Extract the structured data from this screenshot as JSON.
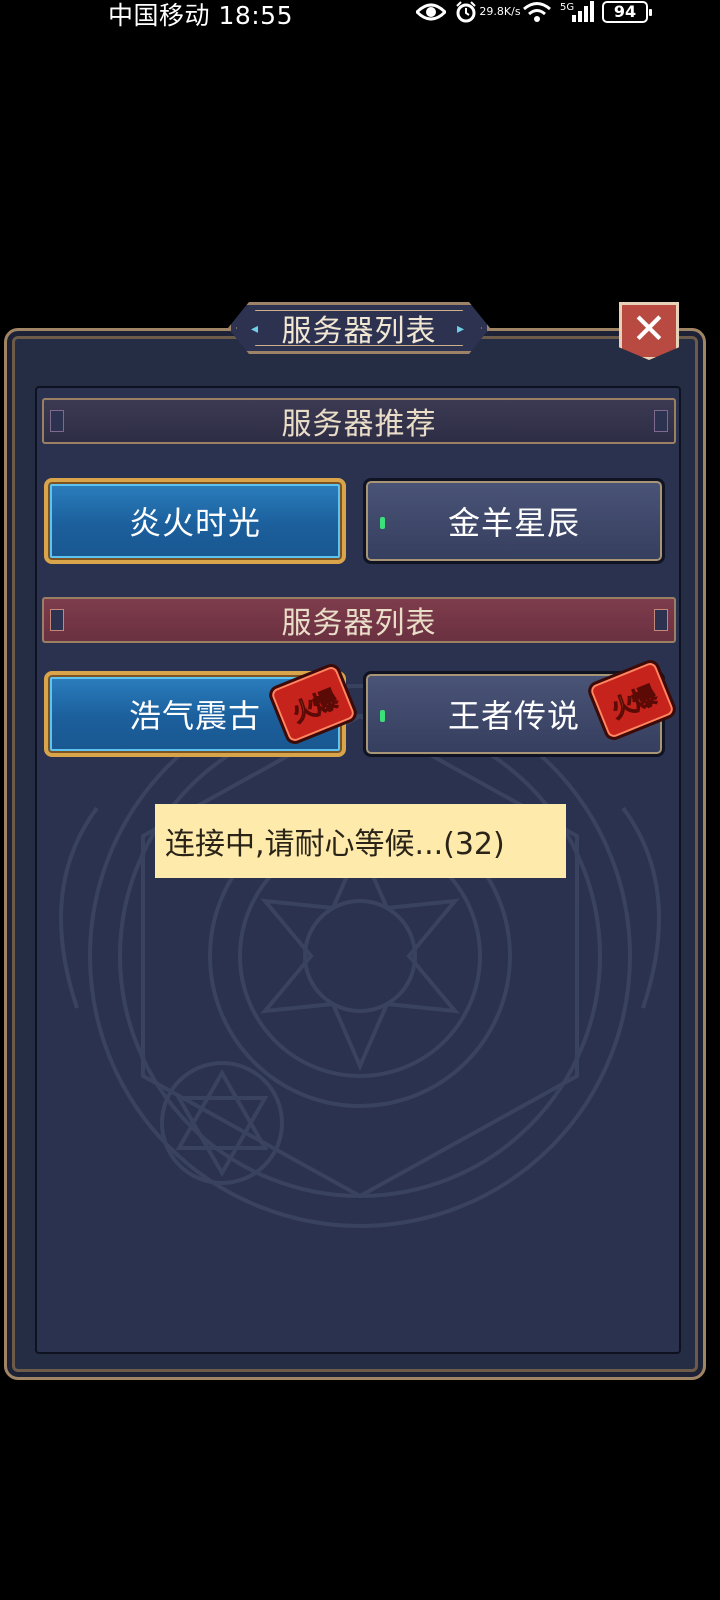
{
  "status_bar": {
    "carrier_time": "中国移动 18:55",
    "net_speed_value": "29.8",
    "net_speed_unit": "K/s",
    "signal_label": "5G",
    "battery": "94"
  },
  "dialog": {
    "title": "服务器列表",
    "close_label": "✕",
    "recommended_header": "服务器推荐",
    "recommended": [
      {
        "name": "炎火时光",
        "state": "selected"
      },
      {
        "name": "金羊星辰",
        "state": "normal"
      }
    ],
    "list_header": "服务器列表",
    "servers": [
      {
        "name": "浩气震古",
        "state": "selected",
        "badge": "火爆"
      },
      {
        "name": "王者传说",
        "state": "normal",
        "badge": "火爆"
      }
    ]
  },
  "toast": {
    "message": "连接中,请耐心等候...(32)"
  },
  "icons": [
    "eye-icon",
    "alarm-icon",
    "wifi-icon",
    "signal-icon",
    "battery-icon",
    "close-icon",
    "magic-circle-icon"
  ],
  "colors": {
    "panel_bg": "#252d45",
    "border_gold": "#a08466",
    "active_button": "#1b5f9c",
    "section_header_red": "#6a3141",
    "badge_red": "#c7231d",
    "toast_bg": "#feeaab"
  }
}
